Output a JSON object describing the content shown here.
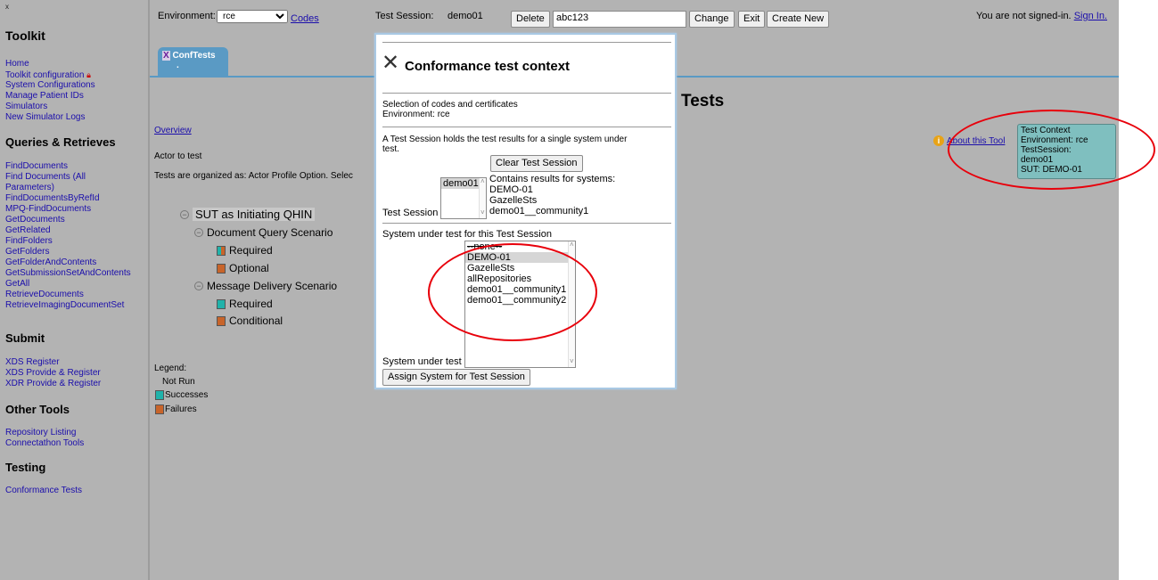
{
  "sidebar": {
    "close": "x",
    "toolkit_title": "Toolkit",
    "toolkit_links": [
      "Home",
      "Toolkit configuration",
      "System Configurations",
      "Manage Patient IDs",
      "Simulators",
      "New Simulator Logs"
    ],
    "queries_title": "Queries & Retrieves",
    "queries_links": [
      "FindDocuments",
      "Find Documents (All",
      "Parameters)",
      "FindDocumentsByRefId",
      "MPQ-FindDocuments",
      "GetDocuments",
      "GetRelated",
      "FindFolders",
      "GetFolders",
      "GetFolderAndContents",
      "GetSubmissionSetAndContents",
      "GetAll",
      "RetrieveDocuments",
      "RetrieveImagingDocumentSet"
    ],
    "submit_title": "Submit",
    "submit_links": [
      "XDS Register",
      "XDS Provide & Register",
      "XDR Provide & Register"
    ],
    "other_title": "Other Tools",
    "other_links": [
      "Repository Listing",
      "Connectathon Tools"
    ],
    "testing_title": "Testing",
    "testing_links": [
      "Conformance Tests"
    ]
  },
  "topbar": {
    "environment_label": "Environment:",
    "environment_value": "rce",
    "codes_link": "Codes",
    "test_session_label": "Test Session:",
    "test_session_value": "demo01",
    "delete_button": "Delete",
    "session_input": "abc123",
    "change_button": "Change",
    "exit_button": "Exit",
    "create_new_button": "Create New",
    "signin_text": "You are not signed-in.",
    "signin_link": "Sign In."
  },
  "tab": {
    "close": "X",
    "label": "ConfTests",
    "sub": "."
  },
  "main": {
    "heading_partial": "Tests",
    "overview_link": "Overview",
    "actor_label": "Actor to test",
    "organized_text": "Tests are organized as: Actor Profile Option. Selec",
    "about_link": "About this Tool",
    "tree": {
      "root": "SUT as Initiating QHIN",
      "scenario1": "Document Query Scenario",
      "s1_opt1": "Required",
      "s1_opt2": "Optional",
      "scenario2": "Message Delivery Scenario",
      "s2_opt1": "Required",
      "s2_opt2": "Conditional"
    },
    "legend": {
      "title": "Legend:",
      "not_run": "Not Run",
      "successes": "Successes",
      "failures": "Failures"
    }
  },
  "test_context": {
    "line1": "Test Context",
    "line2": "Environment: rce",
    "line3": "TestSession:",
    "line4": "demo01",
    "line5": "SUT: DEMO-01"
  },
  "modal": {
    "title": "Conformance test context",
    "codes_line": "Selection of codes and certificates",
    "env_line": "Environment: rce",
    "desc_line1": "A Test Session holds the test results for a single system under",
    "desc_line2": "test.",
    "clear_button": "Clear Test Session",
    "session_list": [
      "demo01"
    ],
    "contains_label": "Contains results for systems:",
    "systems": [
      "DEMO-01",
      "GazelleSts",
      "demo01__community1"
    ],
    "test_session_label": "Test Session",
    "sut_heading": "System under test for this Test Session",
    "sut_options": [
      "--none--",
      "DEMO-01",
      "GazelleSts",
      "allRepositories",
      "demo01__community1",
      "demo01__community2"
    ],
    "sut_label": "System under test",
    "assign_button": "Assign System for Test Session"
  },
  "colors": {
    "success": "#20b2aa",
    "failure": "#c8642a",
    "highlight": "#e8000b"
  }
}
